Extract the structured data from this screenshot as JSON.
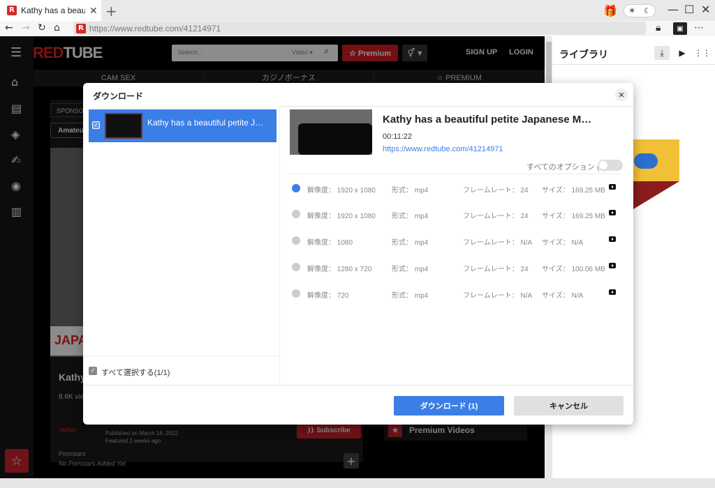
{
  "browser": {
    "tab_title": "Kathy has a beau",
    "tab_close": "✕",
    "new_tab": "+",
    "url": "https://www.redtube.com/41214971",
    "favicon_letter": "R",
    "controls": {
      "minimize": "—",
      "maximize": "☐",
      "close": "✕",
      "more": "⋯"
    },
    "theme_sun": "☀",
    "theme_moon": "☾"
  },
  "site": {
    "logo_red": "RED",
    "logo_white": "TUBE",
    "search_placeholder": "Search...",
    "search_category": "Video ▾",
    "premium_label": "☆ Premium",
    "gender_label": "⚥ ▾",
    "signup": "SIGN UP",
    "login": "LOGIN",
    "nav": [
      "CAM SEX",
      "カジノボーナス",
      "☆ PREMIUM"
    ],
    "sponsored": "SPONSO",
    "amateur": "Amateu",
    "japan_banner": "JAPA",
    "video_title_partial": "Kathy",
    "views_partial": "8.6K vie",
    "japan_chip": "JAPAN",
    "published": "Published on March 16, 2022",
    "featured": "Featured 2 weeks ago",
    "subscribe": "Subscribe",
    "pornstars_label": "Pornstars",
    "no_pornstars": "No Pornstars Added Yet",
    "premium_videos": "Premium Videos"
  },
  "library": {
    "title": "ライブラリ"
  },
  "modal": {
    "title": "ダウンロード",
    "close": "✕",
    "item_title": "Kathy has a beautiful petite J…",
    "select_all": "すべて選択する(1/1)",
    "video_title": "Kathy has a beautiful petite Japanese M…",
    "duration": "00:11:22",
    "url": "https://www.redtube.com/41214971",
    "all_options": "すべてのオプション (9)",
    "options": [
      {
        "resolution": "解像度： 1920 x 1080",
        "format": "形式： mp4",
        "framerate": "フレームレート： 24",
        "size": "サイズ： 169.25 MB",
        "selected": true
      },
      {
        "resolution": "解像度： 1920 x 1080",
        "format": "形式： mp4",
        "framerate": "フレームレート： 24",
        "size": "サイズ： 169.25 MB",
        "selected": false
      },
      {
        "resolution": "解像度： 1080",
        "format": "形式： mp4",
        "framerate": "フレームレート： N/A",
        "size": "サイズ： N/A",
        "selected": false
      },
      {
        "resolution": "解像度： 1280 x 720",
        "format": "形式： mp4",
        "framerate": "フレームレート： 24",
        "size": "サイズ： 100.06 MB",
        "selected": false
      },
      {
        "resolution": "解像度： 720",
        "format": "形式： mp4",
        "framerate": "フレームレート： N/A",
        "size": "サイズ： N/A",
        "selected": false
      }
    ],
    "download_label": "ダウンロード (1)",
    "cancel_label": "キャンセル"
  },
  "colors": {
    "accent": "#3b7ee6",
    "brand_red": "#d01e23"
  }
}
